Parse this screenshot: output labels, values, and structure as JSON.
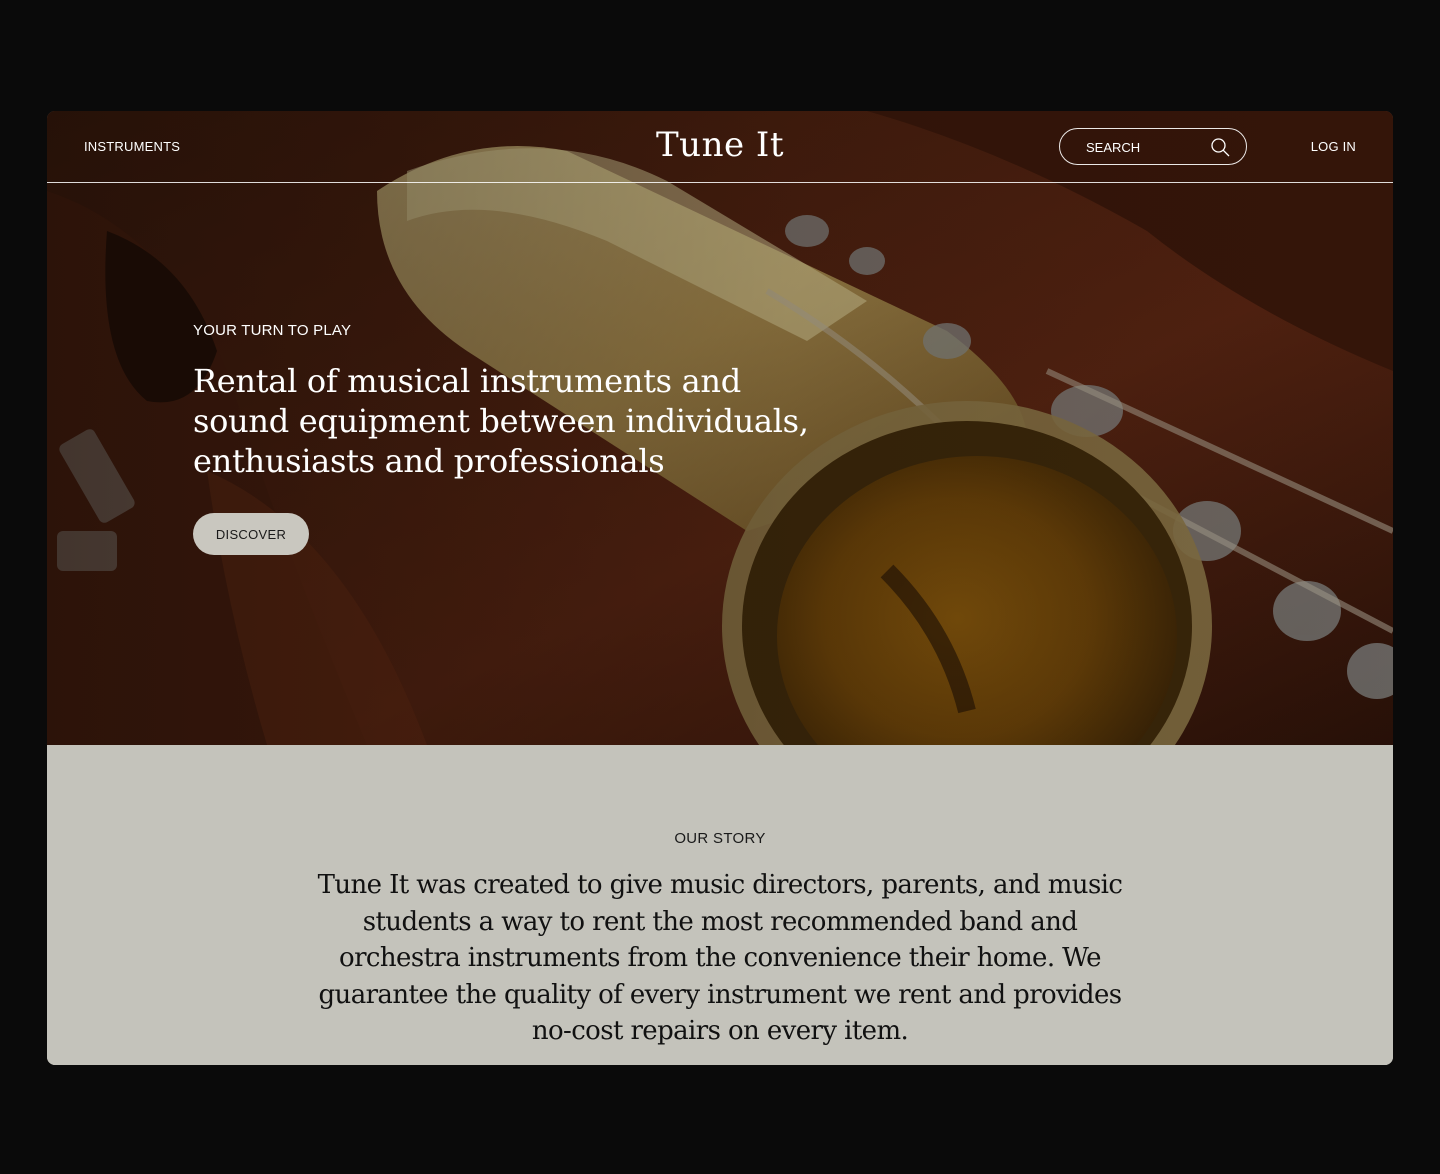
{
  "nav": {
    "instruments_label": "INSTRUMENTS",
    "logo": "Tune It",
    "search_placeholder": "SEARCH",
    "login_label": "LOG IN"
  },
  "hero": {
    "eyebrow": "YOUR TURN TO PLAY",
    "headline": "Rental of musical instruments and sound equipment between individuals, enthusiasts and professionals",
    "cta_label": "DISCOVER",
    "background_image": "saxophone-in-case"
  },
  "story": {
    "label": "OUR STORY",
    "text": "Tune It was created to give music directors, parents, and music students a way to rent the most recommended band and orchestra instruments from the convenience their home. We guarantee the quality of every instrument we rent and provides no-cost repairs on every item."
  },
  "colors": {
    "page_background": "#0a0a0a",
    "story_background": "#c4c3bb",
    "button_background": "#c9c7bf",
    "hero_text": "#ffffff"
  }
}
